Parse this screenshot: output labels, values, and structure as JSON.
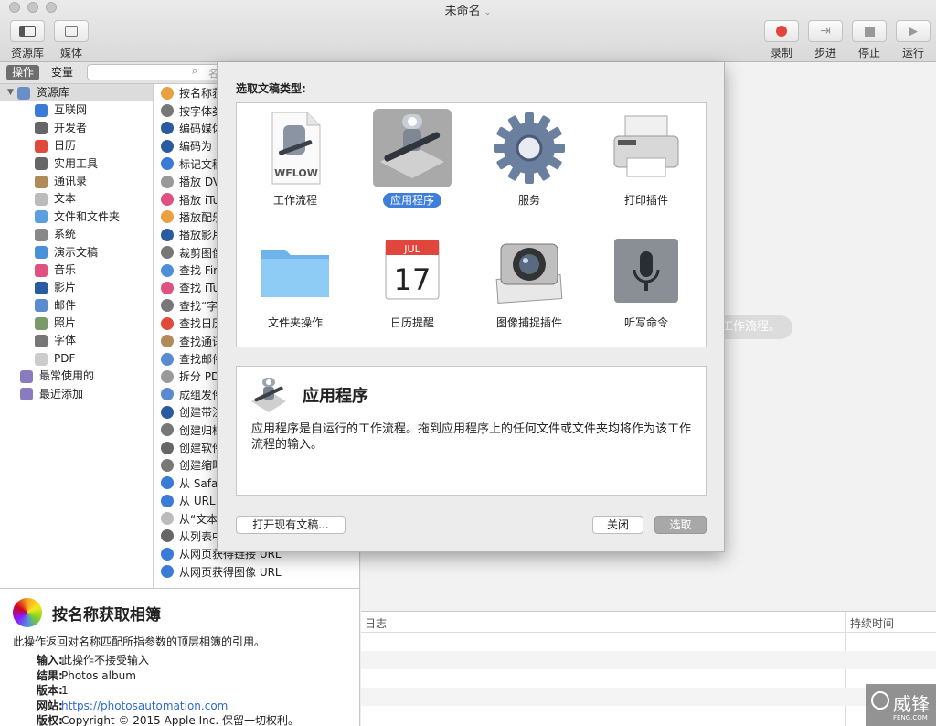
{
  "window": {
    "title": "未命名"
  },
  "toolbar": {
    "library": "资源库",
    "media": "媒体",
    "record": "录制",
    "step": "步进",
    "stop": "停止",
    "run": "运行"
  },
  "tabs": {
    "actions": "操作",
    "variables": "变量"
  },
  "search": {
    "placeholder": "名"
  },
  "categories": [
    {
      "label": "资源库",
      "icon": "library-icon",
      "color": "#6a8fc7"
    },
    {
      "label": "互联网",
      "icon": "globe-icon",
      "color": "#3a7bd5"
    },
    {
      "label": "开发者",
      "icon": "tools-icon",
      "color": "#666666"
    },
    {
      "label": "日历",
      "icon": "calendar-icon",
      "color": "#e04a3a"
    },
    {
      "label": "实用工具",
      "icon": "tools-icon",
      "color": "#666666"
    },
    {
      "label": "通讯录",
      "icon": "contacts-icon",
      "color": "#b08a5a"
    },
    {
      "label": "文本",
      "icon": "text-icon",
      "color": "#bbbbbb"
    },
    {
      "label": "文件和文件夹",
      "icon": "folder-icon",
      "color": "#5aa0e0"
    },
    {
      "label": "系统",
      "icon": "gear-icon",
      "color": "#888888"
    },
    {
      "label": "演示文稿",
      "icon": "presentation-icon",
      "color": "#4a90d9"
    },
    {
      "label": "音乐",
      "icon": "music-icon",
      "color": "#e05080"
    },
    {
      "label": "影片",
      "icon": "movie-icon",
      "color": "#2a5aa0"
    },
    {
      "label": "邮件",
      "icon": "mail-icon",
      "color": "#5a8ad0"
    },
    {
      "label": "照片",
      "icon": "photos-icon",
      "color": "#7a9a6a"
    },
    {
      "label": "字体",
      "icon": "font-icon",
      "color": "#777777"
    },
    {
      "label": "PDF",
      "icon": "pdf-icon",
      "color": "#cccccc"
    },
    {
      "label": "最常使用的",
      "icon": "smart-folder-icon",
      "color": "#8a7ac0"
    },
    {
      "label": "最近添加",
      "icon": "smart-folder-icon",
      "color": "#8a7ac0"
    }
  ],
  "actions": [
    {
      "label": "按名称获",
      "color": "#e8a040"
    },
    {
      "label": "按字体类",
      "color": "#777777"
    },
    {
      "label": "编码媒体",
      "color": "#2a5aa0"
    },
    {
      "label": "编码为 M",
      "color": "#2a5aa0"
    },
    {
      "label": "标记文稿",
      "color": "#3a7bd5"
    },
    {
      "label": "播放 DV",
      "color": "#999999"
    },
    {
      "label": "播放 iTu",
      "color": "#e05080"
    },
    {
      "label": "播放配乐",
      "color": "#e8a040"
    },
    {
      "label": "播放影片",
      "color": "#2a5aa0"
    },
    {
      "label": "裁剪图像",
      "color": "#777777"
    },
    {
      "label": "查找 Fin",
      "color": "#4a90d9"
    },
    {
      "label": "查找 iTu",
      "color": "#e05080"
    },
    {
      "label": "查找“字",
      "color": "#777777"
    },
    {
      "label": "查找日历",
      "color": "#e04a3a"
    },
    {
      "label": "查找通讯",
      "color": "#b08a5a"
    },
    {
      "label": "查找邮件",
      "color": "#5a8ad0"
    },
    {
      "label": "拆分 PD",
      "color": "#999999"
    },
    {
      "label": "成组发件",
      "color": "#5a8ad0"
    },
    {
      "label": "创建带注",
      "color": "#2a5aa0"
    },
    {
      "label": "创建归档",
      "color": "#777777"
    },
    {
      "label": "创建软件",
      "color": "#666666"
    },
    {
      "label": "创建缩略",
      "color": "#777777"
    },
    {
      "label": "从 Safar",
      "color": "#3a7bd5"
    },
    {
      "label": "从 URL",
      "color": "#3a7bd5"
    },
    {
      "label": "从“文本",
      "color": "#bbbbbb"
    },
    {
      "label": "从列表中",
      "color": "#666666"
    },
    {
      "label": "从网页获得链接 URL",
      "color": "#3a7bd5"
    },
    {
      "label": "从网页获得图像 URL",
      "color": "#3a7bd5"
    }
  ],
  "description": {
    "title": "按名称获取相簿",
    "summary": "此操作返回对名称匹配所指参数的顶层相簿的引用。",
    "fields": [
      {
        "key": "输入:",
        "value": "此操作不接受输入"
      },
      {
        "key": "结果:",
        "value": "Photos album"
      },
      {
        "key": "版本:",
        "value": "1"
      },
      {
        "key": "网站:",
        "value": "https://photosautomation.com"
      },
      {
        "key": "版权:",
        "value": "Copyright © 2015 Apple Inc. 保留一切权利。"
      }
    ]
  },
  "canvas": {
    "hint": "工作流程。"
  },
  "log": {
    "col_log": "日志",
    "col_duration": "持续时间"
  },
  "sheet": {
    "prompt": "选取文稿类型:",
    "types": [
      {
        "label": "工作流程",
        "icon": "workflow-document-icon",
        "badge": "WFLOW"
      },
      {
        "label": "应用程序",
        "icon": "automator-robot-icon",
        "selected": true
      },
      {
        "label": "服务",
        "icon": "gear-icon"
      },
      {
        "label": "打印插件",
        "icon": "printer-icon"
      },
      {
        "label": "文件夹操作",
        "icon": "folder-icon"
      },
      {
        "label": "日历提醒",
        "icon": "calendar-icon",
        "month": "JUL",
        "day": "17"
      },
      {
        "label": "图像捕捉插件",
        "icon": "camera-icon"
      },
      {
        "label": "听写命令",
        "icon": "microphone-icon"
      }
    ],
    "info_title": "应用程序",
    "info_text": "应用程序是自运行的工作流程。拖到应用程序上的任何文件或文件夹均将作为该工作流程的输入。",
    "open_button": "打开现有文稿...",
    "close_button": "关闭",
    "choose_button": "选取"
  },
  "watermark": {
    "text": "威锋",
    "sub": "FENG.COM"
  },
  "colors": {
    "selection": "#3d7fd9",
    "record": "#e0463c"
  }
}
